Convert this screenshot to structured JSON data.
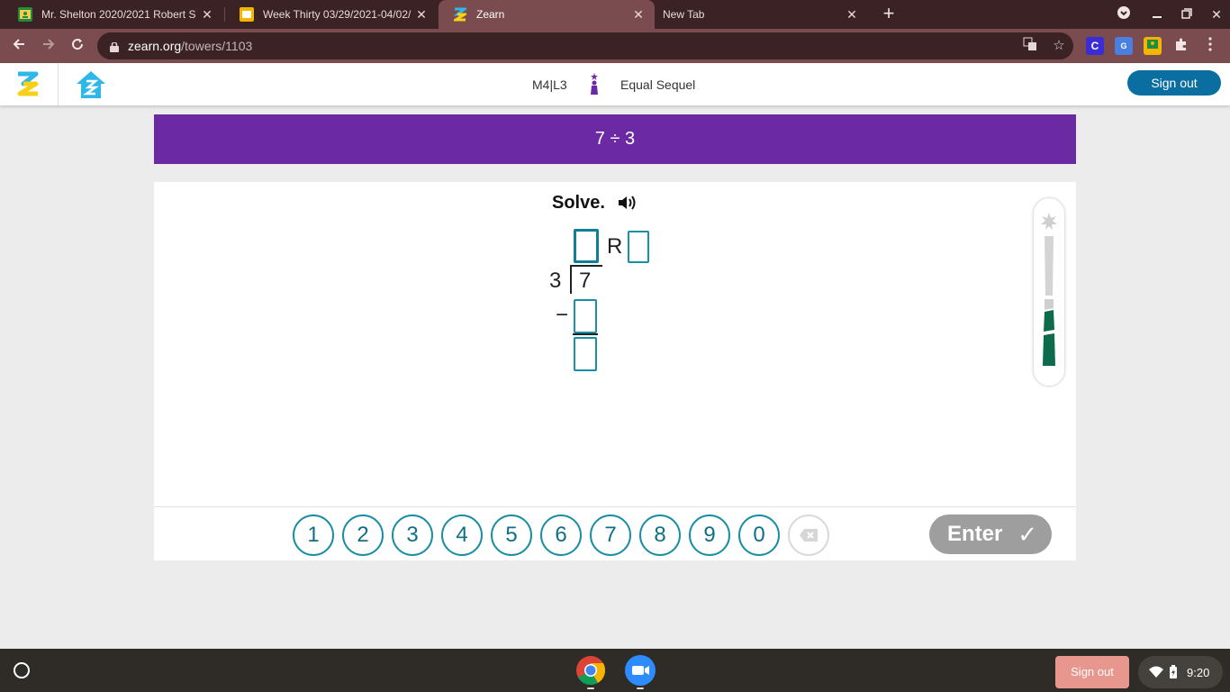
{
  "browser": {
    "tabs": [
      {
        "title": "Mr. Shelton 2020/2021 Robert S",
        "favicon": "google-classroom-icon",
        "color": "#1e8e3e"
      },
      {
        "title": "Week Thirty 03/29/2021-04/02/",
        "favicon": "google-slides-icon",
        "color": "#f4b400"
      },
      {
        "title": "Zearn",
        "favicon": "zearn-icon",
        "color": "#2fb7e8"
      },
      {
        "title": "New Tab",
        "favicon": "",
        "color": ""
      }
    ],
    "active_tab_index": 2,
    "url_host": "zearn.org",
    "url_path": "/towers/1103"
  },
  "header": {
    "lesson_code": "M4|L3",
    "lesson_name": "Equal Sequel",
    "sign_out_label": "Sign out"
  },
  "banner": {
    "expression": "7 ÷ 3"
  },
  "problem": {
    "instruction": "Solve.",
    "divisor": "3",
    "dividend": "7",
    "remainder_label": "R",
    "minus_sign": "−",
    "quotient_value": "",
    "remainder_value": "",
    "subtract_value": "",
    "difference_value": ""
  },
  "keypad": {
    "keys": [
      "1",
      "2",
      "3",
      "4",
      "5",
      "6",
      "7",
      "8",
      "9",
      "0"
    ],
    "enter_label": "Enter",
    "enter_check": "✓"
  },
  "shelf": {
    "sign_out_label": "Sign out",
    "time": "9:20"
  },
  "colors": {
    "banner": "#6b2aa3",
    "accent": "#1a8ea3",
    "enter_disabled": "#9e9e9e",
    "progress_fill": "#0b6b4a"
  }
}
